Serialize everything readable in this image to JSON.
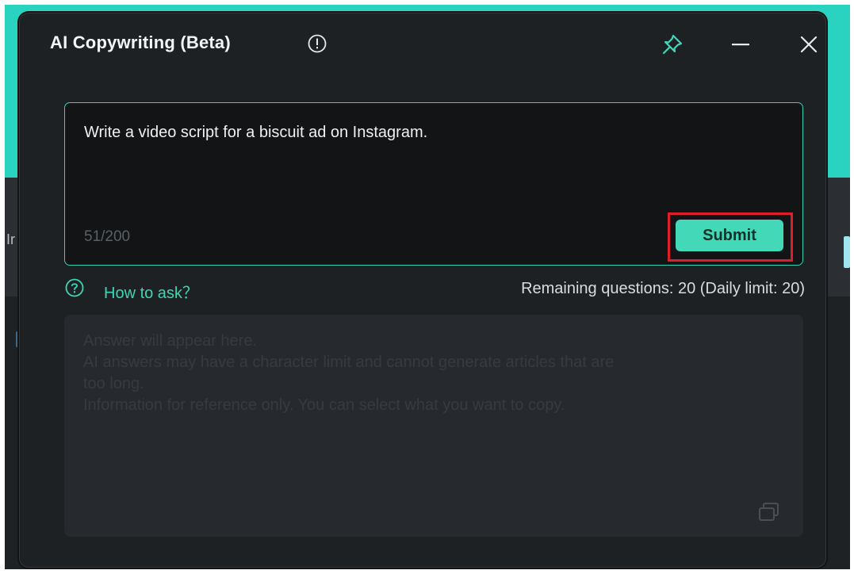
{
  "background": {
    "left_partial_text": "Ir"
  },
  "dialog": {
    "title": "AI Copywriting (Beta)",
    "icons": {
      "info": "info-icon",
      "pin": "pin-icon",
      "minimize": "minimize-icon",
      "close": "close-icon",
      "help": "help-icon",
      "copy": "copy-icon"
    },
    "prompt": {
      "value": "Write a video script for a biscuit ad on Instagram.",
      "char_count": "51/200"
    },
    "submit_label": "Submit",
    "help_link": "How to ask？",
    "remaining": "Remaining questions: 20 (Daily limit: 20)",
    "answer_placeholder": [
      "Answer will appear here.",
      "AI answers may have a character limit and cannot generate articles that are",
      "too long.",
      "Information for reference only. You can select what you want to copy."
    ]
  },
  "colors": {
    "accent": "#43d9b8",
    "highlight_border": "#e01e27",
    "teal_background": "#2ad3bf",
    "dialog_bg": "#1e2124"
  }
}
